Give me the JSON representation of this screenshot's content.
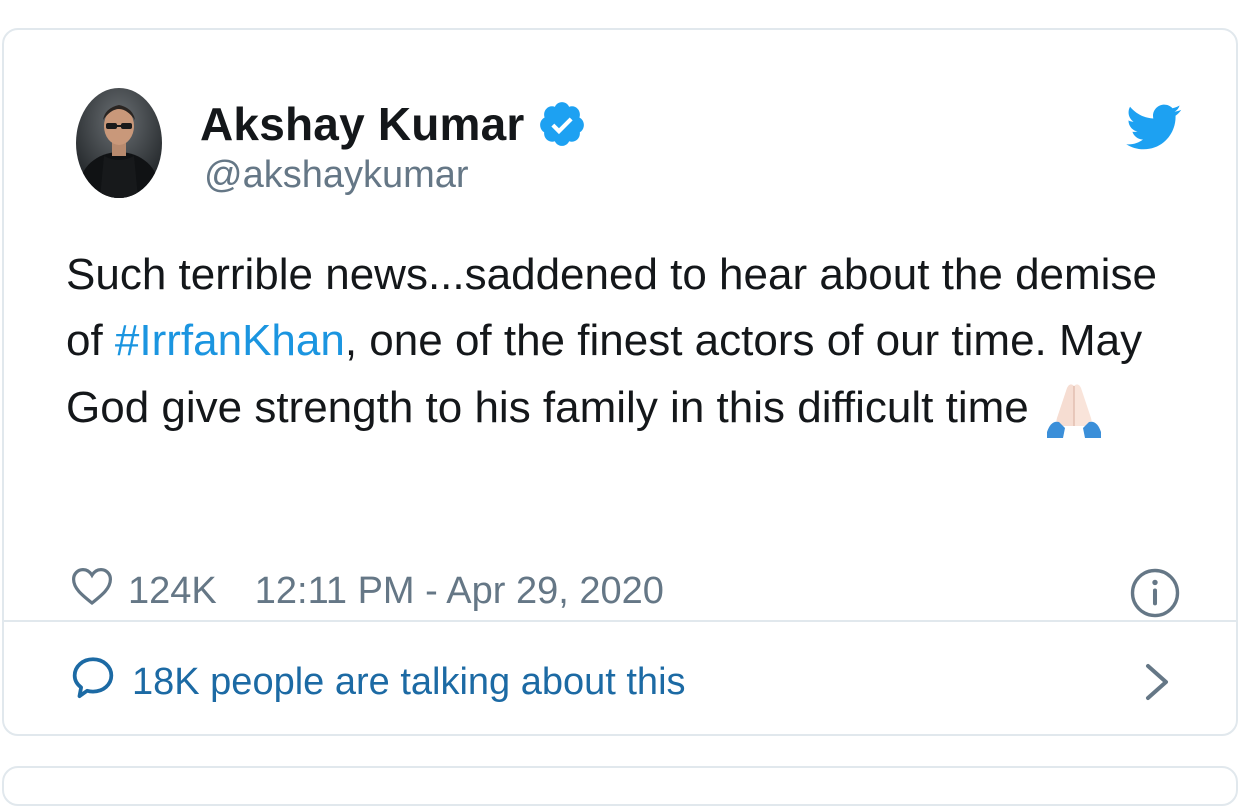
{
  "author": {
    "name": "Akshay Kumar",
    "handle": "@akshaykumar",
    "verified": true,
    "verified_icon": "verified-badge-icon",
    "avatar": "avatar-photo"
  },
  "platform_icon": "twitter-bird-icon",
  "tweet": {
    "text_before": "Such terrible news...saddened to hear about the demise of ",
    "hashtag": "#IrrfanKhan",
    "text_after": ", one of the finest actors of our time. May God give strength to his family in this difficult time ",
    "emoji": "folded-hands-emoji"
  },
  "meta": {
    "like_icon": "heart-icon",
    "likes": "124K",
    "timestamp": "12:11 PM - Apr 29, 2020",
    "info_icon": "info-icon"
  },
  "conversation": {
    "icon": "speech-bubble-icon",
    "label": "18K people are talking about this",
    "chevron_icon": "chevron-right-icon"
  },
  "colors": {
    "text": "#14171a",
    "secondary": "#657786",
    "link": "#1b95e0",
    "conversation_link": "#1c6aa4",
    "twitter_blue": "#1da1f2",
    "border": "#e1e8ed"
  }
}
